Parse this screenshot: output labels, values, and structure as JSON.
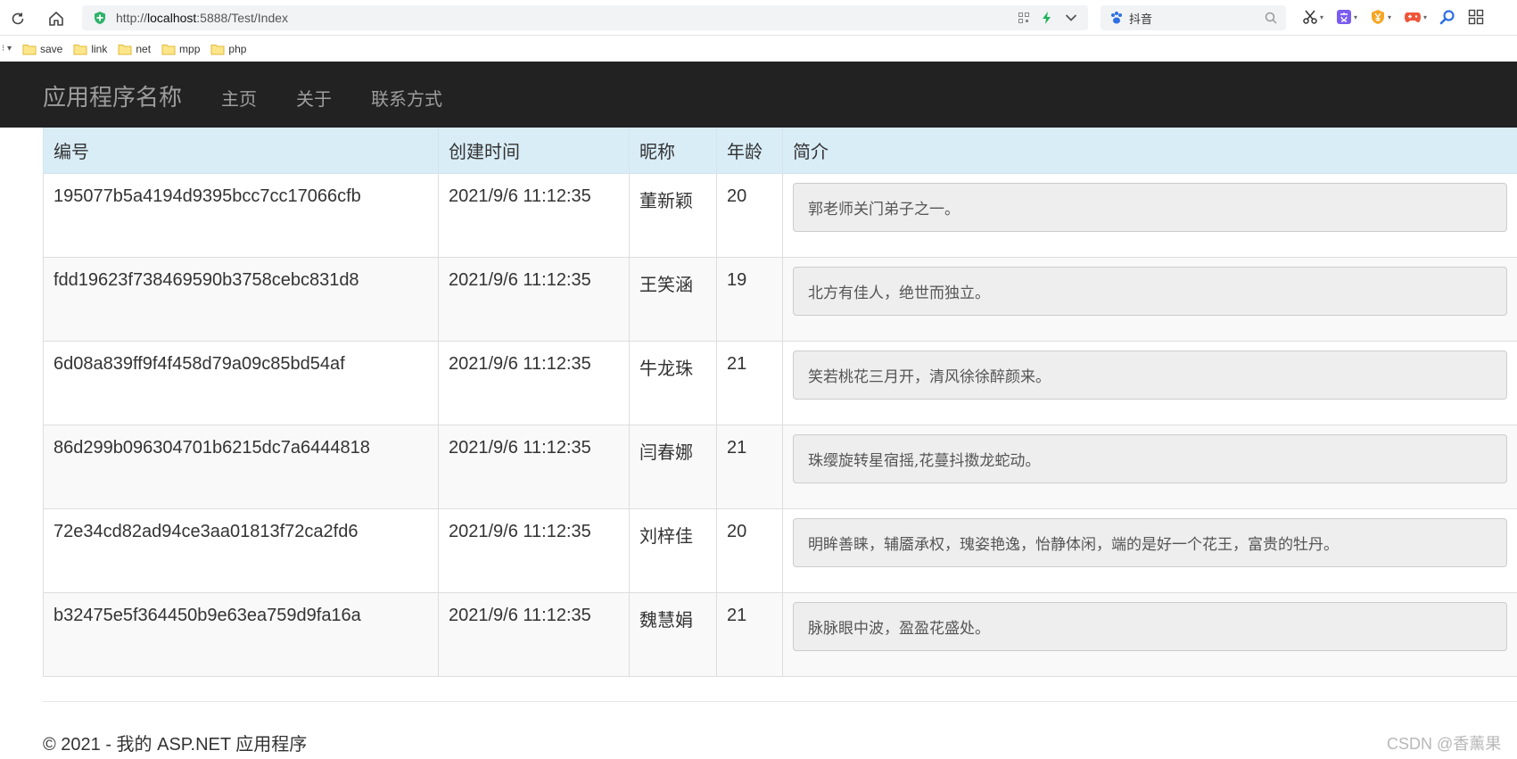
{
  "browser": {
    "url_prefix": "http://",
    "url_host": "localhost",
    "url_rest": ":5888/Test/Index",
    "search_text": "抖音",
    "bookmarks": [
      {
        "label": "save"
      },
      {
        "label": "link"
      },
      {
        "label": "net"
      },
      {
        "label": "mpp"
      },
      {
        "label": "php"
      }
    ]
  },
  "navbar": {
    "brand": "应用程序名称",
    "links": [
      "主页",
      "关于",
      "联系方式"
    ]
  },
  "table": {
    "headers": [
      "编号",
      "创建时间",
      "昵称",
      "年龄",
      "简介"
    ],
    "rows": [
      {
        "id": "195077b5a4194d9395bcc7cc17066cfb",
        "created": "2021/9/6 11:12:35",
        "nickname": "董新颖",
        "age": "20",
        "intro": "郭老师关门弟子之一。"
      },
      {
        "id": "fdd19623f738469590b3758cebc831d8",
        "created": "2021/9/6 11:12:35",
        "nickname": "王笑涵",
        "age": "19",
        "intro": "北方有佳人，绝世而独立。"
      },
      {
        "id": "6d08a839ff9f4f458d79a09c85bd54af",
        "created": "2021/9/6 11:12:35",
        "nickname": "牛龙珠",
        "age": "21",
        "intro": "笑若桃花三月开，清风徐徐醉颜来。"
      },
      {
        "id": "86d299b096304701b6215dc7a6444818",
        "created": "2021/9/6 11:12:35",
        "nickname": "闫春娜",
        "age": "21",
        "intro": "珠缨旋转星宿摇,花蔓抖擞龙蛇动。"
      },
      {
        "id": "72e34cd82ad94ce3aa01813f72ca2fd6",
        "created": "2021/9/6 11:12:35",
        "nickname": "刘梓佳",
        "age": "20",
        "intro": "明眸善睐，辅靥承权，瑰姿艳逸，怡静体闲，端的是好一个花王，富贵的牡丹。"
      },
      {
        "id": "b32475e5f364450b9e63ea759d9fa16a",
        "created": "2021/9/6 11:12:35",
        "nickname": "魏慧娟",
        "age": "21",
        "intro": "脉脉眼中波，盈盈花盛处。"
      }
    ]
  },
  "footer": {
    "text": "© 2021 - 我的 ASP.NET 应用程序"
  },
  "watermark": "CSDN @香薰果",
  "colors": {
    "navbar_bg": "#222222",
    "navbar_text": "#9d9d9d",
    "header_bg": "#d9edf7",
    "stripe_bg": "#f9f9f9",
    "intro_bg": "#eeeeee"
  }
}
